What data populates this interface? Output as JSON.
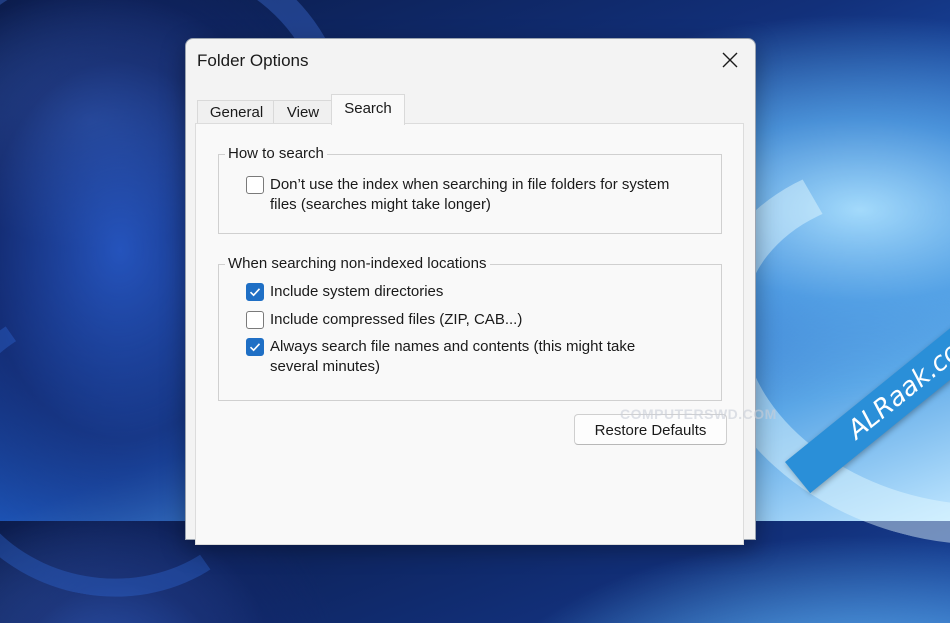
{
  "window": {
    "title": "Folder Options"
  },
  "tabs": [
    {
      "label": "General",
      "active": false
    },
    {
      "label": "View",
      "active": false
    },
    {
      "label": "Search",
      "active": true
    }
  ],
  "how_to_search": {
    "legend": "How to search",
    "options": [
      {
        "label_line1": "Don’t use the index when searching in file folders for system",
        "label_line2": "files (searches might take longer)",
        "checked": false
      }
    ]
  },
  "non_indexed": {
    "legend": "When searching non-indexed locations",
    "options": [
      {
        "label_line1": "Include system directories",
        "checked": true
      },
      {
        "label_line1": "Include compressed files (ZIP, CAB...)",
        "checked": false
      },
      {
        "label_line1": "Always search file names and contents (this might take",
        "label_line2": "several minutes)",
        "checked": true
      }
    ]
  },
  "buttons": {
    "restore_defaults": "Restore Defaults"
  },
  "watermarks": {
    "center": "COMPUTERSWD.COM",
    "corner": "ALRaak.com"
  },
  "colors": {
    "checkbox_checked": "#1f6fc5",
    "ribbon": "#2a8fd8"
  }
}
